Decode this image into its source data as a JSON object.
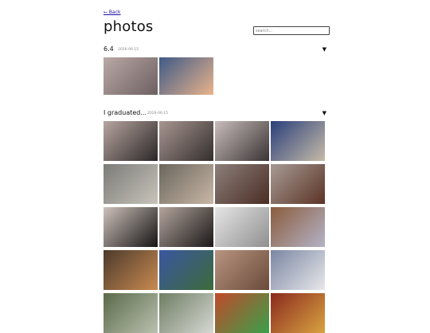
{
  "nav": {
    "back_label": "← Back"
  },
  "page": {
    "title": "photos"
  },
  "search": {
    "placeholder": "search..."
  },
  "albums": [
    {
      "title": "6.4",
      "date": "2026-06-15",
      "toggle": "▼",
      "photos": [
        {
          "alt": "photo",
          "c1": "#b9a9a6",
          "c2": "#6d5f61"
        },
        {
          "alt": "photo",
          "c1": "#3f5a86",
          "c2": "#e9b38c"
        }
      ]
    },
    {
      "title": "I graduated...",
      "date": "2026-06-15",
      "toggle": "▼",
      "photos": [
        {
          "alt": "photo",
          "c1": "#b7a5a0",
          "c2": "#2b2727"
        },
        {
          "alt": "photo",
          "c1": "#a89690",
          "c2": "#332e2e"
        },
        {
          "alt": "photo",
          "c1": "#c9bcbc",
          "c2": "#3a3434"
        },
        {
          "alt": "photo",
          "c1": "#2a3f7a",
          "c2": "#c6bba8"
        },
        {
          "alt": "photo",
          "c1": "#7b7b78",
          "c2": "#c8c4ba"
        },
        {
          "alt": "photo",
          "c1": "#6a665d",
          "c2": "#c9b7a6"
        },
        {
          "alt": "photo",
          "c1": "#8c7f7a",
          "c2": "#4b2d24"
        },
        {
          "alt": "photo",
          "c1": "#a79b94",
          "c2": "#5b3325"
        },
        {
          "alt": "photo",
          "c1": "#cfc2bb",
          "c2": "#151414"
        },
        {
          "alt": "photo",
          "c1": "#b3a49c",
          "c2": "#1a1818"
        },
        {
          "alt": "photo",
          "c1": "#e6e6e6",
          "c2": "#8f8f8f"
        },
        {
          "alt": "photo",
          "c1": "#8a5c3c",
          "c2": "#b4b3c8"
        },
        {
          "alt": "photo",
          "c1": "#4c3a2c",
          "c2": "#c88a50"
        },
        {
          "alt": "photo",
          "c1": "#3a56a0",
          "c2": "#3d6b3b"
        },
        {
          "alt": "photo",
          "c1": "#b89480",
          "c2": "#6a4a3a"
        },
        {
          "alt": "photo",
          "c1": "#7a86a2",
          "c2": "#e8e8ea"
        },
        {
          "alt": "photo",
          "c1": "#5b6a49",
          "c2": "#b9c0b0"
        },
        {
          "alt": "photo",
          "c1": "#6f7e64",
          "c2": "#d6d8d3"
        },
        {
          "alt": "photo",
          "c1": "#c04a2b",
          "c2": "#3aa04a"
        },
        {
          "alt": "photo",
          "c1": "#8a2a1e",
          "c2": "#d9a340"
        }
      ]
    }
  ]
}
